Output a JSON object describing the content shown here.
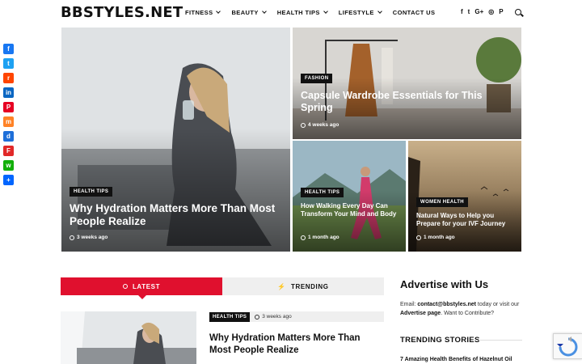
{
  "header": {
    "logo": "BBSTYLES.NET",
    "nav": [
      {
        "label": "FITNESS",
        "dropdown": true
      },
      {
        "label": "BEAUTY",
        "dropdown": true
      },
      {
        "label": "HEALTH TIPS",
        "dropdown": true
      },
      {
        "label": "LIFESTYLE",
        "dropdown": true
      },
      {
        "label": "CONTACT US",
        "dropdown": false
      }
    ],
    "social": [
      "facebook-icon",
      "twitter-icon",
      "google-plus-icon",
      "instagram-icon",
      "pinterest-icon"
    ],
    "social_glyphs": [
      "f",
      "t",
      "G+",
      "◎",
      "P"
    ]
  },
  "share_bar": [
    {
      "name": "facebook-share",
      "color": "#1877f2",
      "glyph": "f"
    },
    {
      "name": "twitter-share",
      "color": "#1da1f2",
      "glyph": "t"
    },
    {
      "name": "reddit-share",
      "color": "#ff4500",
      "glyph": "r"
    },
    {
      "name": "linkedin-share",
      "color": "#0a66c2",
      "glyph": "in"
    },
    {
      "name": "pinterest-share",
      "color": "#e60023",
      "glyph": "P"
    },
    {
      "name": "mix-share",
      "color": "#ff8226",
      "glyph": "m"
    },
    {
      "name": "diaspora-share",
      "color": "#1e6fd9",
      "glyph": "d"
    },
    {
      "name": "flipboard-share",
      "color": "#e12828",
      "glyph": "F"
    },
    {
      "name": "whatsapp-share",
      "color": "#12af0a",
      "glyph": "w"
    },
    {
      "name": "more-share",
      "color": "#0166ff",
      "glyph": "+"
    }
  ],
  "featured": {
    "main": {
      "category": "HEALTH TIPS",
      "title": "Why Hydration Matters More Than Most People Realize",
      "time": "3 weeks ago"
    },
    "top_right": {
      "category": "FASHION",
      "title": "Capsule Wardrobe Essentials for This Spring",
      "time": "4 weeks ago"
    },
    "bottom_mid": {
      "category": "HEALTH TIPS",
      "title": "How Walking Every Day Can Transform Your Mind and Body",
      "time": "1 month ago"
    },
    "bottom_right": {
      "category": "WOMEN HEALTH",
      "title": "Natural Ways to Help you Prepare for your IVF Journey",
      "time": "1 month ago"
    }
  },
  "tabs": {
    "latest": "LATEST",
    "trending": "TRENDING"
  },
  "latest_post": {
    "category": "HEALTH TIPS",
    "time": "3 weeks ago",
    "title": "Why Hydration Matters More Than Most People Realize"
  },
  "sidebar": {
    "advertise_title": "Advertise with Us",
    "advert_prefix": "Email: ",
    "advert_email": "contact@bbstyles.net",
    "advert_mid": " today or visit our ",
    "advert_link": "Advertise page",
    "advert_suffix": ". Want to Contribute?",
    "trending_title": "TRENDING STORIES",
    "trending_first": "7 Amazing Health Benefits of Hazelnut Oil"
  },
  "colors": {
    "accent": "#e0102e",
    "dark": "#111111"
  }
}
